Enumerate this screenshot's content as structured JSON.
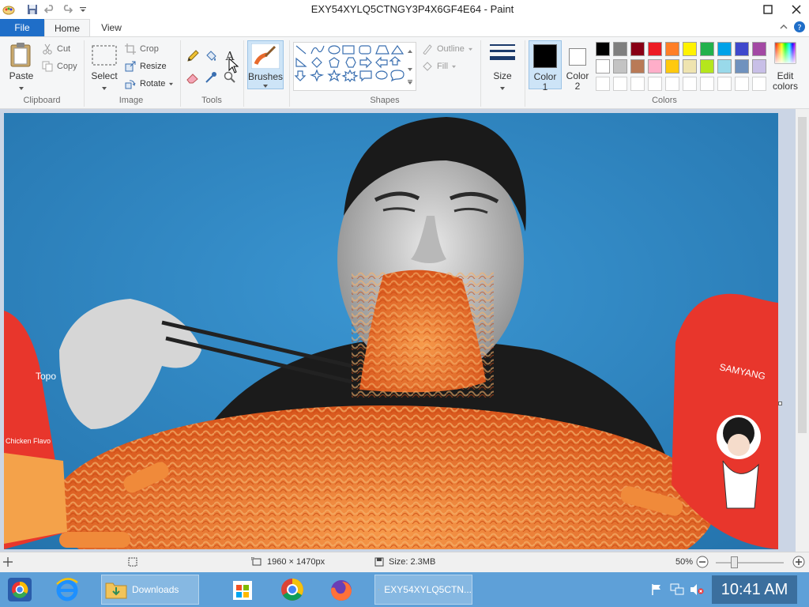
{
  "window": {
    "title": "EXY54XYLQ5CTNGY3P4X6GF4E64 - Paint"
  },
  "quick_access": {
    "icons": [
      "paint-app-icon",
      "save-icon",
      "undo-icon",
      "redo-icon",
      "customize-dropdown-icon"
    ]
  },
  "tabs": {
    "file": "File",
    "home": "Home",
    "view": "View"
  },
  "clipboard": {
    "paste": "Paste",
    "cut": "Cut",
    "copy": "Copy",
    "label": "Clipboard"
  },
  "image_group": {
    "select": "Select",
    "crop": "Crop",
    "resize": "Resize",
    "rotate": "Rotate",
    "label": "Image"
  },
  "tools": {
    "label": "Tools"
  },
  "brushes": {
    "label": "Brushes"
  },
  "shapes": {
    "outline": "Outline",
    "fill": "Fill",
    "label": "Shapes"
  },
  "size": {
    "label": "Size"
  },
  "colors": {
    "color1": "Color",
    "color1_num": "1",
    "color2": "Color",
    "color2_num": "2",
    "edit_line1": "Edit",
    "edit_line2": "colors",
    "label": "Colors",
    "color1_value": "#000000",
    "color2_value": "#ffffff",
    "row1": [
      "#000000",
      "#7f7f7f",
      "#880015",
      "#ed1c24",
      "#ff7f27",
      "#fff200",
      "#22b14c",
      "#00a2e8",
      "#3f48cc",
      "#a349a4"
    ],
    "row2": [
      "#ffffff",
      "#c3c3c3",
      "#b97a57",
      "#ffaec9",
      "#ffc90e",
      "#efe4b0",
      "#b5e61d",
      "#99d9ea",
      "#7092be",
      "#c8bfe7"
    ],
    "row3": [
      "#ffffff",
      "#ffffff",
      "#ffffff",
      "#ffffff",
      "#ffffff",
      "#ffffff",
      "#ffffff",
      "#ffffff",
      "#ffffff",
      "#ffffff"
    ]
  },
  "canvas_image": {
    "package_text_left": "Topo",
    "package_text_left2": "Chicken Flavo",
    "package_brand_right": "SAMYANG"
  },
  "status": {
    "dimensions": "1960 × 1470px",
    "size": "Size: 2.3MB",
    "zoom": "50%"
  },
  "taskbar": {
    "downloads": "Downloads",
    "paint_window": "EXY54XYLQ5CTN...",
    "time": "10:41 AM"
  }
}
